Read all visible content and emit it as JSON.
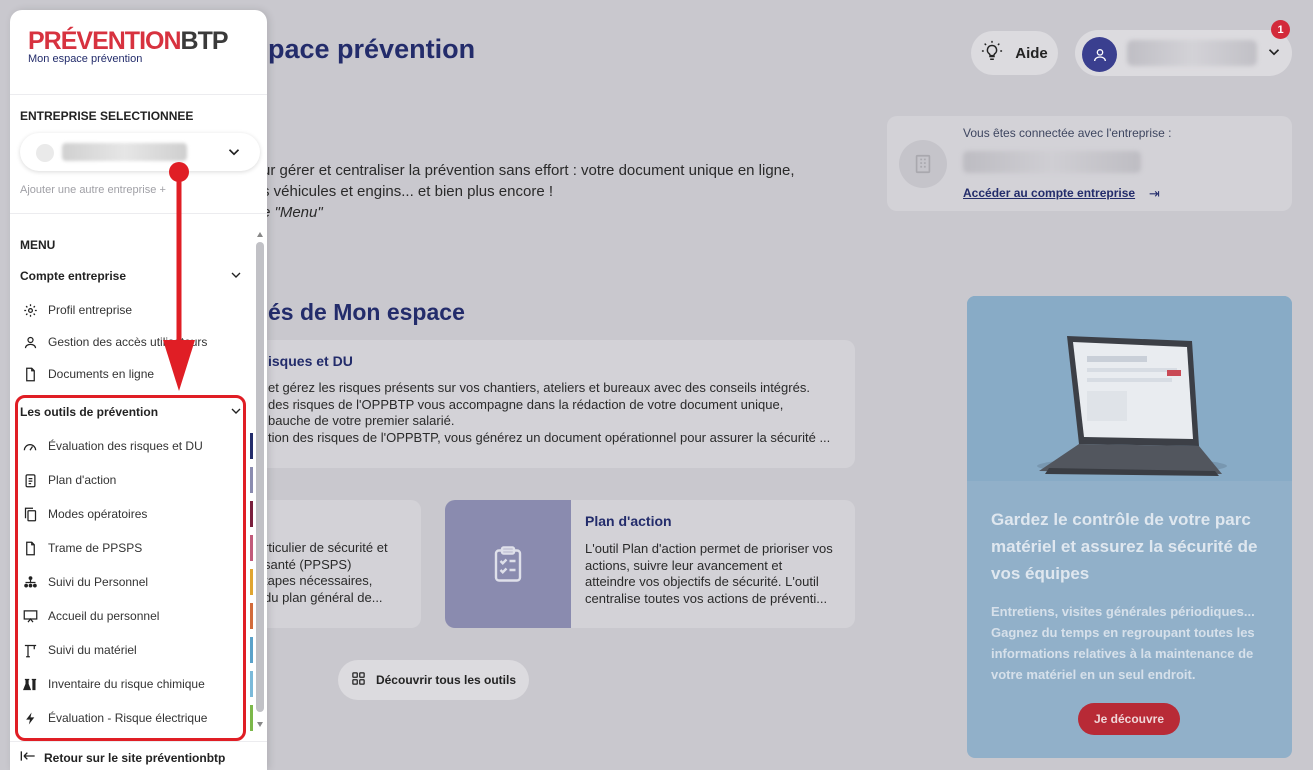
{
  "header": {
    "title": "pace prévention",
    "help_label": "Aide",
    "notif_count": "1"
  },
  "intro": {
    "line1": "ur gérer et centraliser la prévention sans effort : votre document unique en ligne,",
    "line2": "s véhicules et engins... et bien plus encore !",
    "line3": "e \"Menu\""
  },
  "connected": {
    "label": "Vous êtes connectée avec l'entreprise :",
    "link": "Accéder au compte entreprise",
    "link_icon": "arrow-right-to-bar-icon"
  },
  "features": {
    "title": "és de Mon espace",
    "card1": {
      "title": "isques et DU",
      "lines": [
        "et gérez les risques présents sur vos chantiers, ateliers et bureaux avec des conseils intégrés.",
        "des risques de l'OPPBTP vous accompagne dans la rédaction de votre document unique,",
        "bauche de votre premier salarié.",
        "tion des risques de l'OPPBTP, vous générez un document opérationnel pour assurer la sécurité ..."
      ]
    },
    "card2": {
      "lines": [
        "rticulier de sécurité et",
        "santé (PPSPS)",
        "tapes nécessaires,",
        "du plan général de..."
      ]
    },
    "card3": {
      "title": "Plan d'action",
      "lines": [
        "L'outil Plan d'action permet de prioriser vos",
        "actions, suivre leur avancement et",
        "atteindre vos objectifs de sécurité. L'outil",
        "centralise toutes vos actions de préventi..."
      ]
    },
    "discover_label": "Découvrir tous les outils"
  },
  "promo": {
    "title": "Gardez le contrôle de votre parc matériel et assurez la sécurité de vos équipes",
    "text": "Entretiens, visites générales périodiques... Gagnez du temps en regroupant toutes les informations relatives à la maintenance de votre matériel en un seul endroit.",
    "button": "Je découvre"
  },
  "sidebar": {
    "logo_red": "PRÉVENTION",
    "logo_dark": "BTP",
    "logo_sub": "Mon espace prévention",
    "entreprise_label": "ENTREPRISE SELECTIONNEE",
    "add_entreprise": "Ajouter une autre entreprise",
    "menu_label": "MENU",
    "group1": {
      "title": "Compte entreprise",
      "items": [
        {
          "label": "Profil entreprise",
          "icon": "gear-icon"
        },
        {
          "label": "Gestion des accès utilisateurs",
          "icon": "user-icon"
        },
        {
          "label": "Documents en ligne",
          "icon": "document-icon"
        }
      ]
    },
    "group2": {
      "title": "Les outils de prévention",
      "items": [
        {
          "label": "Évaluation des risques et DU",
          "icon": "gauge-icon",
          "color": "#232c6b"
        },
        {
          "label": "Plan d'action",
          "icon": "checklist-icon",
          "color": "#8a8baf"
        },
        {
          "label": "Modes opératoires",
          "icon": "copy-icon",
          "color": "#7a1f3d"
        },
        {
          "label": "Trame de PPSPS",
          "icon": "file-icon",
          "color": "#c15a7a"
        },
        {
          "label": "Suivi du Personnel",
          "icon": "org-chart-icon",
          "color": "#e0a531"
        },
        {
          "label": "Accueil du personnel",
          "icon": "presentation-icon",
          "color": "#d26b3b"
        },
        {
          "label": "Suivi du matériel",
          "icon": "crane-icon",
          "color": "#5aa1c9"
        },
        {
          "label": "Inventaire du risque chimique",
          "icon": "flask-icon",
          "color": "#7bb9d9"
        },
        {
          "label": "Évaluation - Risque électrique",
          "icon": "bolt-icon",
          "color": "#7cb84a"
        }
      ]
    },
    "back_label": "Retour sur le site préventionbtp"
  }
}
